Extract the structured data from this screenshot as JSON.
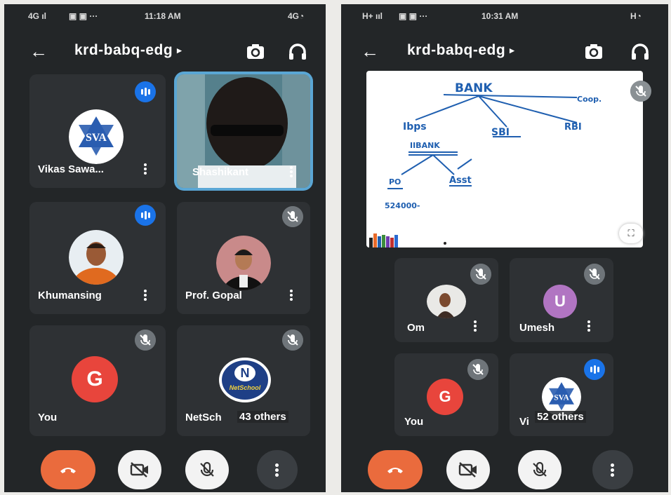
{
  "left_screen": {
    "status": {
      "network": "4G ıl",
      "time": "11:18 AM",
      "battery": "4G◔"
    },
    "appbar": {
      "back_icon": "←",
      "meeting_code": "krd-babq-edg",
      "caret": "▸",
      "camera_switch_icon": "camera-switch-icon",
      "audio_icon": "headphones-icon"
    },
    "participants": [
      {
        "name": "Vikas Sawa...",
        "state": "speaking",
        "avatar": "sva-logo"
      },
      {
        "name": "Shashikant",
        "state": "active-video"
      },
      {
        "name": "Khumansing",
        "state": "speaking"
      },
      {
        "name": "Prof. Gopal",
        "state": "muted"
      },
      {
        "name": "You",
        "state": "muted",
        "avatar_letter": "G"
      },
      {
        "name": "NetSch",
        "state": "muted",
        "avatar": "netschool-logo",
        "logo_text": "NetSchool"
      }
    ],
    "others_label": "43 others"
  },
  "right_screen": {
    "status": {
      "network": "H+ ııl",
      "time": "10:31 AM",
      "battery": "H◔"
    },
    "appbar": {
      "back_icon": "←",
      "meeting_code": "krd-babq-edg",
      "caret": "▸",
      "camera_switch_icon": "camera-switch-icon",
      "audio_icon": "headphones-icon"
    },
    "whiteboard": {
      "words": [
        "BANK",
        "Coop.",
        "Ibps",
        "SBI",
        "RBI",
        "IIBANK",
        "PO",
        "Asst",
        "524000-"
      ]
    },
    "participants": [
      {
        "name": "Om",
        "state": "muted"
      },
      {
        "name": "Umesh",
        "state": "muted",
        "avatar_letter": "U"
      },
      {
        "name": "You",
        "state": "muted",
        "avatar_letter": "G"
      },
      {
        "name": "Vi",
        "state": "speaking",
        "avatar": "sva-logo"
      }
    ],
    "others_label": "52 others"
  },
  "colors": {
    "background": "#232628",
    "tile": "#2e3134",
    "end_call": "#ea6b3d",
    "speaking": "#1a73e8",
    "mute_badge": "#6f757a",
    "avatar_red": "#e8453c",
    "avatar_purple": "#b175c2"
  }
}
